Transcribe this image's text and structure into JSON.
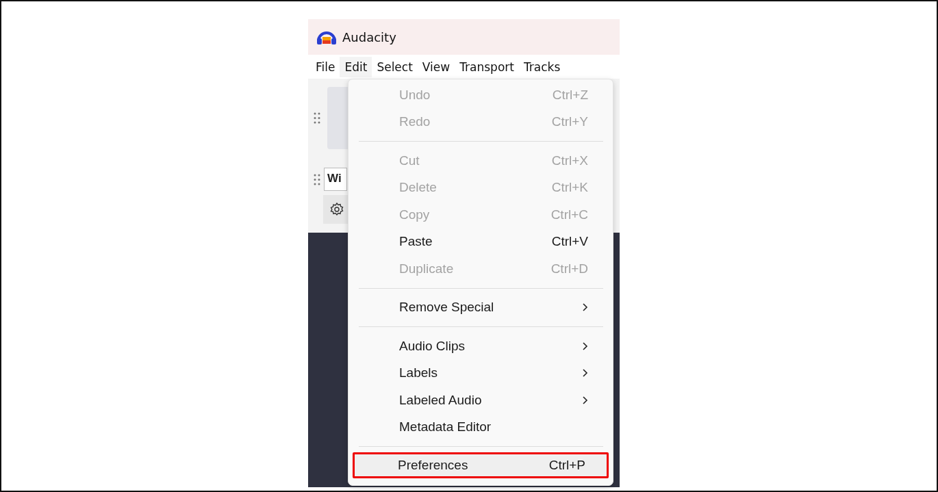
{
  "window": {
    "title": "Audacity"
  },
  "menubar": [
    {
      "label": "File",
      "selected": false
    },
    {
      "label": "Edit",
      "selected": true
    },
    {
      "label": "Select",
      "selected": false
    },
    {
      "label": "View",
      "selected": false
    },
    {
      "label": "Transport",
      "selected": false
    },
    {
      "label": "Tracks",
      "selected": false
    }
  ],
  "toolbar": {
    "field_value": "Wi"
  },
  "edit_menu": [
    {
      "kind": "item",
      "label": "Undo",
      "shortcut": "Ctrl+Z",
      "disabled": true,
      "submenu": false,
      "highlighted": false
    },
    {
      "kind": "item",
      "label": "Redo",
      "shortcut": "Ctrl+Y",
      "disabled": true,
      "submenu": false,
      "highlighted": false
    },
    {
      "kind": "separator"
    },
    {
      "kind": "item",
      "label": "Cut",
      "shortcut": "Ctrl+X",
      "disabled": true,
      "submenu": false,
      "highlighted": false
    },
    {
      "kind": "item",
      "label": "Delete",
      "shortcut": "Ctrl+K",
      "disabled": true,
      "submenu": false,
      "highlighted": false
    },
    {
      "kind": "item",
      "label": "Copy",
      "shortcut": "Ctrl+C",
      "disabled": true,
      "submenu": false,
      "highlighted": false
    },
    {
      "kind": "item",
      "label": "Paste",
      "shortcut": "Ctrl+V",
      "disabled": false,
      "submenu": false,
      "highlighted": false
    },
    {
      "kind": "item",
      "label": "Duplicate",
      "shortcut": "Ctrl+D",
      "disabled": true,
      "submenu": false,
      "highlighted": false
    },
    {
      "kind": "separator"
    },
    {
      "kind": "item",
      "label": "Remove Special",
      "disabled": false,
      "submenu": true,
      "highlighted": false
    },
    {
      "kind": "separator"
    },
    {
      "kind": "item",
      "label": "Audio Clips",
      "disabled": false,
      "submenu": true,
      "highlighted": false
    },
    {
      "kind": "item",
      "label": "Labels",
      "disabled": false,
      "submenu": true,
      "highlighted": false
    },
    {
      "kind": "item",
      "label": "Labeled Audio",
      "disabled": false,
      "submenu": true,
      "highlighted": false
    },
    {
      "kind": "item",
      "label": "Metadata Editor",
      "disabled": false,
      "submenu": false,
      "highlighted": false
    },
    {
      "kind": "separator"
    },
    {
      "kind": "item",
      "label": "Preferences",
      "shortcut": "Ctrl+P",
      "disabled": false,
      "submenu": false,
      "highlighted": true
    }
  ]
}
